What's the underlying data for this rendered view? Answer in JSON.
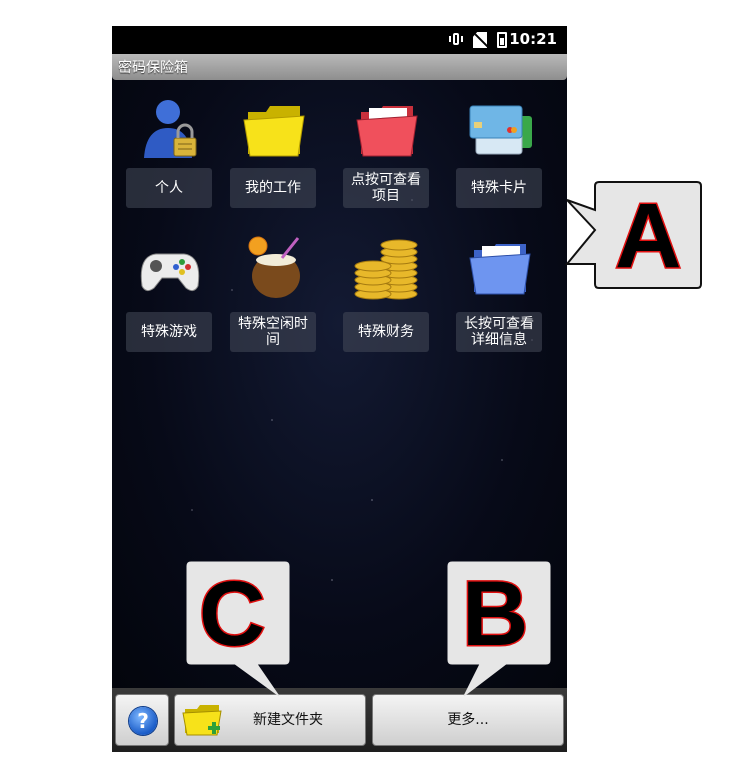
{
  "status_bar": {
    "time": "10:21",
    "icons": [
      "vibrate-icon",
      "no-sim-icon",
      "battery-icon"
    ]
  },
  "app": {
    "title": "密码保险箱"
  },
  "folders": [
    {
      "label": "个人",
      "icon": "user-lock-icon"
    },
    {
      "label": "我的工作",
      "icon": "yellow-folder-icon"
    },
    {
      "label": "点按可查看\n项目",
      "icon": "red-folder-icon"
    },
    {
      "label": "特殊卡片",
      "icon": "credit-cards-icon"
    },
    {
      "label": "特殊游戏",
      "icon": "gamepad-icon"
    },
    {
      "label": "特殊空闲时\n间",
      "icon": "coconut-drink-icon"
    },
    {
      "label": "特殊财务",
      "icon": "coins-icon"
    },
    {
      "label": "长按可查看\n详细信息",
      "icon": "blue-folder-icon"
    }
  ],
  "bottom_bar": {
    "help_label": "?",
    "new_folder_label": "新建文件夹",
    "more_label": "更多..."
  },
  "callouts": {
    "a": "A",
    "b": "B",
    "c": "C"
  },
  "colors": {
    "callout_fill": "#e6e6e6",
    "callout_letter": "#000000",
    "callout_outline": "#e01010"
  }
}
